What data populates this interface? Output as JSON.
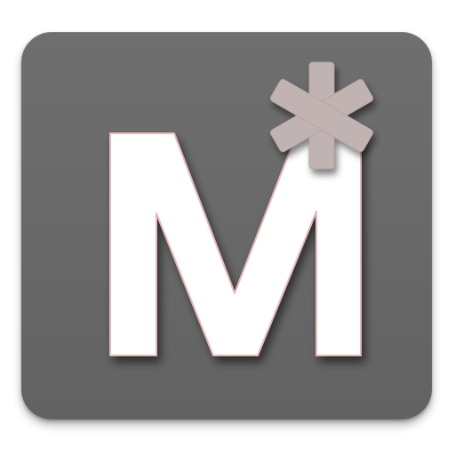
{
  "app_icon": {
    "letter": "M",
    "mark": "*",
    "icon_name": "markdown-editor-app-icon",
    "colors": {
      "tile": "#686868",
      "letter": "#ffffff",
      "letter_outline": "#e7b9b9",
      "asterisk": "#c2b3b3",
      "shadow": "#3a3a3a"
    }
  }
}
